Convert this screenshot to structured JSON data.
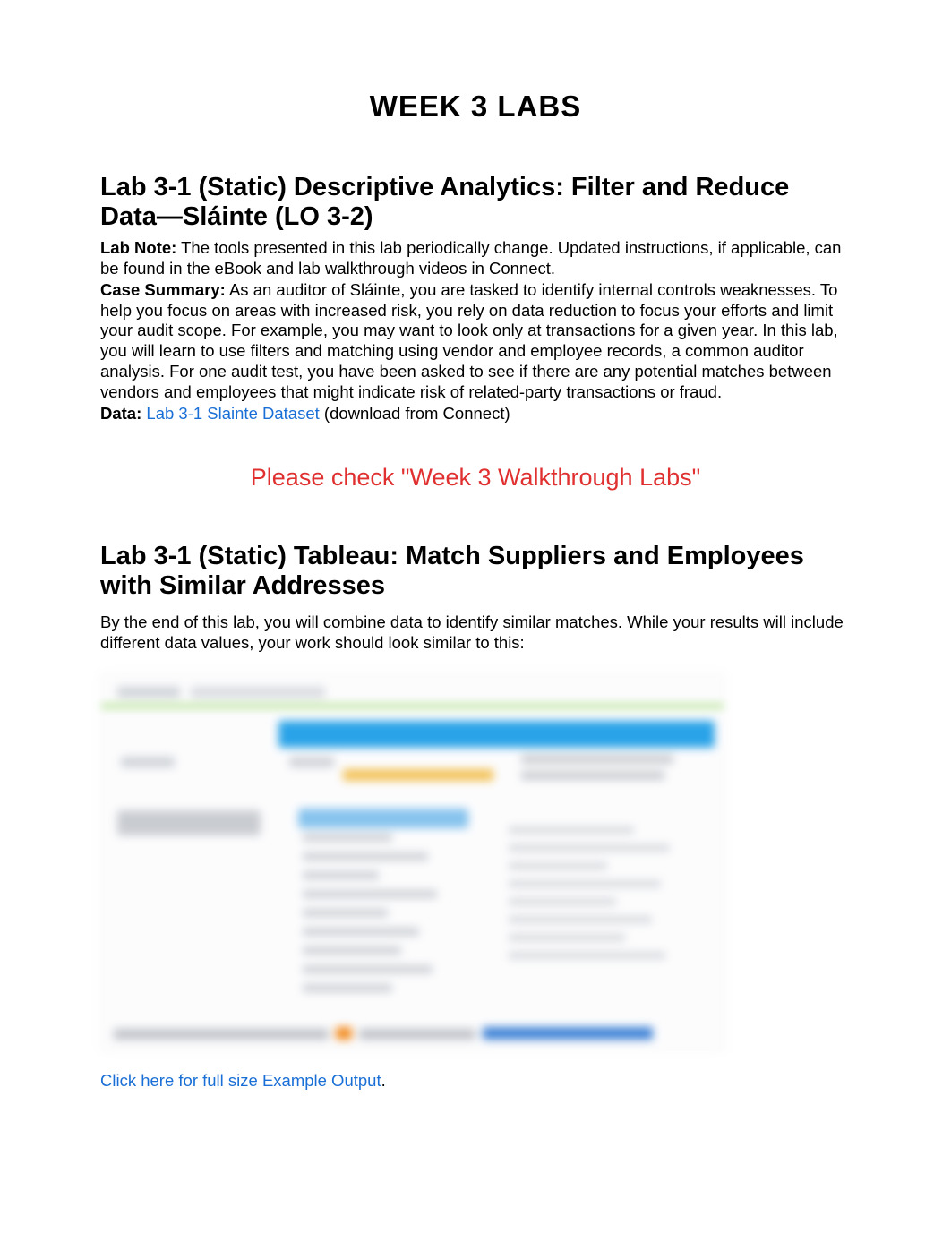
{
  "doc": {
    "title": "WEEK 3 LABS"
  },
  "section1": {
    "heading": "Lab 3-1 (Static) Descriptive Analytics: Filter and Reduce Data—Sláinte (LO 3-2)",
    "lab_note_label": "Lab Note:",
    "lab_note_text": " The tools presented in this lab periodically change. Updated instructions, if applicable, can be found in the eBook and lab walkthrough videos in Connect.",
    "case_summary_label": "Case Summary:",
    "case_summary_text": " As an auditor of Sláinte, you are tasked to identify internal controls weaknesses. To help you focus on areas with increased risk, you rely on data reduction to focus your efforts and limit your audit scope. For example, you may want to look only at transactions for a given year. In this lab, you will learn to use filters and matching using vendor and employee records, a common auditor analysis. For one audit test, you have been asked to see if there are any potential matches between vendors and employees that might indicate risk of related-party transactions or fraud.",
    "data_label": "Data:",
    "data_link": " Lab 3-1 Slainte Dataset",
    "data_after": " (download from Connect)"
  },
  "notice": {
    "text": "Please check \"Week 3 Walkthrough Labs\""
  },
  "section2": {
    "heading": "Lab 3-1 (Static) Tableau: Match Suppliers and Employees with Similar Addresses",
    "intro": "By the end of this lab, you will combine data to identify similar matches. While your results will include different data values, your work should look similar to this:"
  },
  "caption": {
    "link": "Click here for full size Example Output",
    "period": "."
  }
}
